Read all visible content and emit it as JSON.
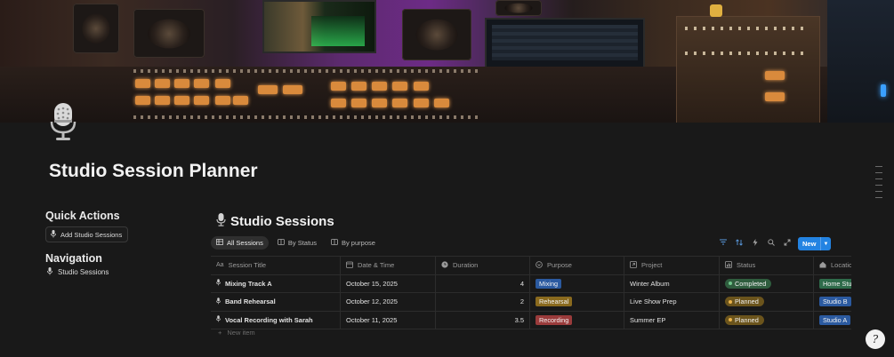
{
  "page": {
    "title": "Studio Session Planner"
  },
  "left": {
    "quick_actions_heading": "Quick Actions",
    "add_session_label": "Add Studio Sessions",
    "navigation_heading": "Navigation",
    "nav_item_label": "Studio Sessions"
  },
  "database": {
    "title": "Studio Sessions",
    "views": [
      {
        "label": "All Sessions",
        "icon": "table-icon",
        "active": true
      },
      {
        "label": "By Status",
        "icon": "board-icon",
        "active": false
      },
      {
        "label": "By purpose",
        "icon": "board-icon",
        "active": false
      }
    ],
    "new_button": "New",
    "columns": [
      "Session Title",
      "Date & Time",
      "Duration",
      "Purpose",
      "Project",
      "Status",
      "Locatio"
    ],
    "rows": [
      {
        "title": "Mixing Track A",
        "date": "October 15, 2025",
        "duration": "4",
        "purpose": "Mixing",
        "purpose_color": "#2b5aa0",
        "project": "Winter Album",
        "status": "Completed",
        "status_bg": "#2f5d3e",
        "status_dot": "#6fc48a",
        "location": "Home Stu",
        "location_color": "#2e6b4a"
      },
      {
        "title": "Band Rehearsal",
        "date": "October 12, 2025",
        "duration": "2",
        "purpose": "Rehearsal",
        "purpose_color": "#8a6a1e",
        "project": "Live Show Prep",
        "status": "Planned",
        "status_bg": "#6b541c",
        "status_dot": "#e8b24a",
        "location": "Studio B",
        "location_color": "#2b5aa0"
      },
      {
        "title": "Vocal Recording with Sarah",
        "date": "October 11, 2025",
        "duration": "3.5",
        "purpose": "Recording",
        "purpose_color": "#9a3b3b",
        "project": "Summer EP",
        "status": "Planned",
        "status_bg": "#6b541c",
        "status_dot": "#e8b24a",
        "location": "Studio A",
        "location_color": "#2b5aa0"
      }
    ],
    "new_item": "New item"
  },
  "help_glyph": "?"
}
